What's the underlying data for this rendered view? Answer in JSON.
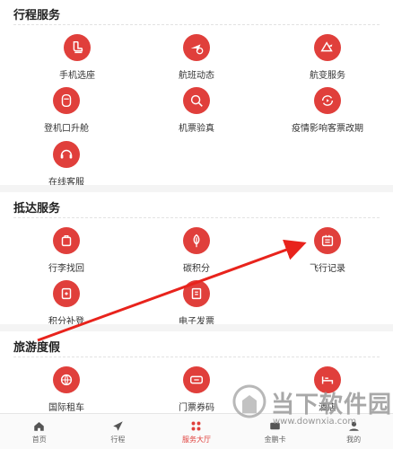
{
  "sections": [
    {
      "title": "行程服务",
      "items": [
        {
          "label": "手机选座",
          "icon": "seat-icon"
        },
        {
          "label": "航班动态",
          "icon": "flight-status-icon"
        },
        {
          "label": "航变服务",
          "icon": "flight-change-icon"
        },
        {
          "label": "登机口升舱",
          "icon": "upgrade-icon"
        },
        {
          "label": "机票验真",
          "icon": "ticket-verify-icon"
        },
        {
          "label": "疫情影响客票改期",
          "icon": "reschedule-icon"
        },
        {
          "label": "在线客服",
          "icon": "customer-service-icon"
        }
      ]
    },
    {
      "title": "抵达服务",
      "items": [
        {
          "label": "行李找回",
          "icon": "luggage-icon"
        },
        {
          "label": "碳积分",
          "icon": "carbon-points-icon"
        },
        {
          "label": "飞行记录",
          "icon": "flight-record-icon"
        },
        {
          "label": "积分补登",
          "icon": "points-makeup-icon"
        },
        {
          "label": "电子发票",
          "icon": "e-invoice-icon"
        }
      ]
    },
    {
      "title": "旅游度假",
      "items": [
        {
          "label": "国际租车",
          "icon": "car-rental-icon"
        },
        {
          "label": "门票券码",
          "icon": "ticket-code-icon"
        },
        {
          "label": "酒店",
          "icon": "hotel-icon"
        }
      ]
    }
  ],
  "tabbar": {
    "items": [
      {
        "label": "首页",
        "icon": "home-icon",
        "active": false
      },
      {
        "label": "行程",
        "icon": "plane-icon",
        "active": false
      },
      {
        "label": "服务大厅",
        "icon": "grid-icon",
        "active": true
      },
      {
        "label": "金鹏卡",
        "icon": "card-icon",
        "active": false
      },
      {
        "label": "我的",
        "icon": "user-icon",
        "active": false
      }
    ]
  },
  "watermark": {
    "text": "当下软件园",
    "url": "www.downxia.com"
  },
  "colors": {
    "accent": "#e03f3b",
    "annotation_arrow": "#e8231c"
  }
}
